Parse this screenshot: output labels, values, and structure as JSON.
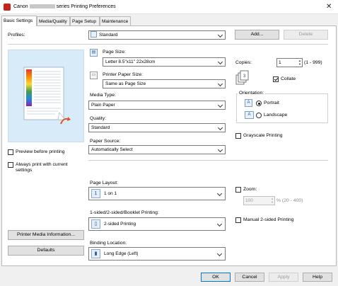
{
  "window": {
    "title_prefix": "Canon",
    "title_suffix": "series Printing Preferences",
    "close_glyph": "✕"
  },
  "tabs": [
    {
      "label": "Basic Settings",
      "active": true
    },
    {
      "label": "Media/Quality",
      "active": false
    },
    {
      "label": "Page Setup",
      "active": false
    },
    {
      "label": "Maintenance",
      "active": false
    }
  ],
  "profiles": {
    "label": "Profiles:",
    "value": "Standard",
    "add_label": "Add...",
    "delete_label": "Delete"
  },
  "left": {
    "preview_before_printing": {
      "label": "Preview before printing",
      "checked": false
    },
    "always_print_line1": "Always print with current",
    "always_print_line2": "settings",
    "always_print_checked": false,
    "printer_media_info_label": "Printer Media Information...",
    "defaults_label": "Defaults"
  },
  "page_size": {
    "label": "Page Size:",
    "value": "Letter 8.5\"x11\" 22x28cm"
  },
  "printer_paper_size": {
    "label": "Printer Paper Size:",
    "value": "Same as Page Size"
  },
  "media_type": {
    "label": "Media Type:",
    "value": "Plain Paper"
  },
  "quality": {
    "label": "Quality:",
    "value": "Standard"
  },
  "paper_source": {
    "label": "Paper Source:",
    "value": "Automatically Select"
  },
  "copies": {
    "label": "Copies:",
    "value": "1",
    "range": "(1 - 999)"
  },
  "collate": {
    "label": "Collate",
    "checked": true
  },
  "orientation": {
    "label": "Orientation:",
    "portrait": {
      "label": "Portrait",
      "checked": true
    },
    "landscape": {
      "label": "Landscape",
      "checked": false
    }
  },
  "grayscale": {
    "label": "Grayscale Printing",
    "checked": false
  },
  "page_layout": {
    "label": "Page Layout:",
    "value": "1 on 1",
    "icon_text": "1"
  },
  "zoom": {
    "label": "Zoom:",
    "checked": false,
    "value": "100",
    "range": "% (20 - 400)"
  },
  "duplex": {
    "label": "1-sided/2-sided/Booklet Printing:",
    "value": "2-sided Printing"
  },
  "manual_duplex": {
    "label": "Manual 2-sided Printing",
    "checked": false
  },
  "binding": {
    "label": "Binding Location:",
    "value": "Long Edge (Left)"
  },
  "bottom": {
    "ok_label": "OK",
    "cancel_label": "Cancel",
    "apply_label": "Apply",
    "help_label": "Help"
  },
  "colors": {
    "preview_bg": "#d8ebf8",
    "titlebar": "#ffffff",
    "dialog_bg": "#f0f0f0"
  }
}
